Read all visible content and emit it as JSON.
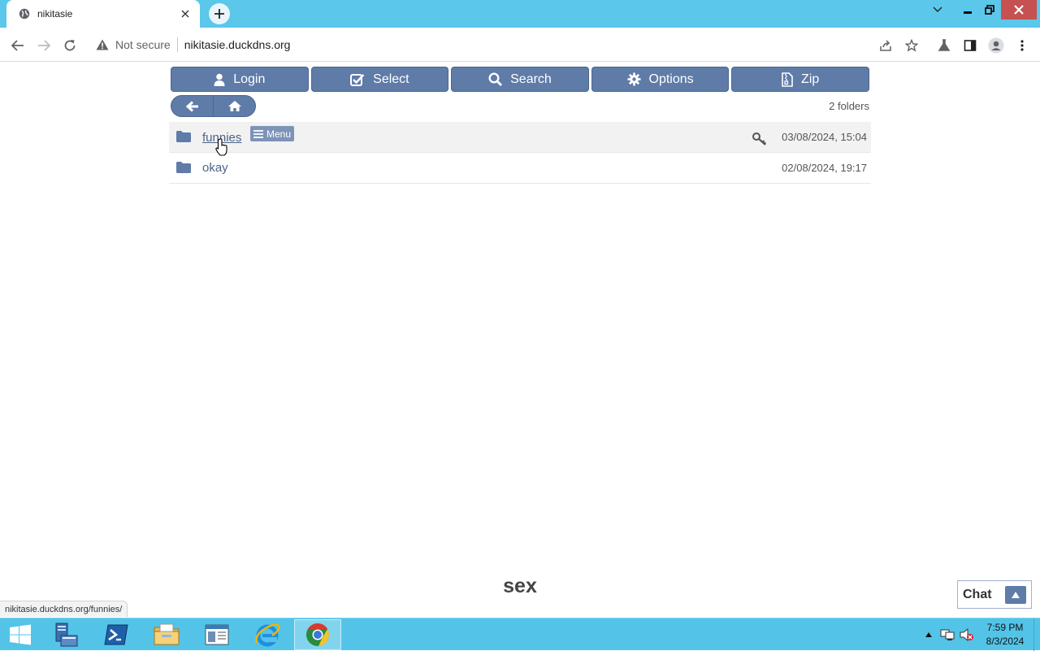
{
  "browser": {
    "tab_title": "nikitasie",
    "security_label": "Not secure",
    "url": "nikitasie.duckdns.org",
    "status_url": "nikitasie.duckdns.org/funnies/"
  },
  "toolbar_buttons": {
    "login": "Login",
    "select": "Select",
    "search": "Search",
    "options": "Options",
    "zip": "Zip"
  },
  "folder_count": "2 folders",
  "folders": [
    {
      "name": "funnies",
      "date": "03/08/2024, 15:04",
      "menu_label": "Menu"
    },
    {
      "name": "okay",
      "date": "02/08/2024, 19:17"
    }
  ],
  "footer": {
    "text": "sex",
    "chat_label": "Chat"
  },
  "taskbar": {
    "time": "7:59 PM",
    "date": "8/3/2024"
  },
  "colors": {
    "accent": "#5f7ba8",
    "taskbar": "#53c4e8",
    "link": "#4d6385"
  }
}
